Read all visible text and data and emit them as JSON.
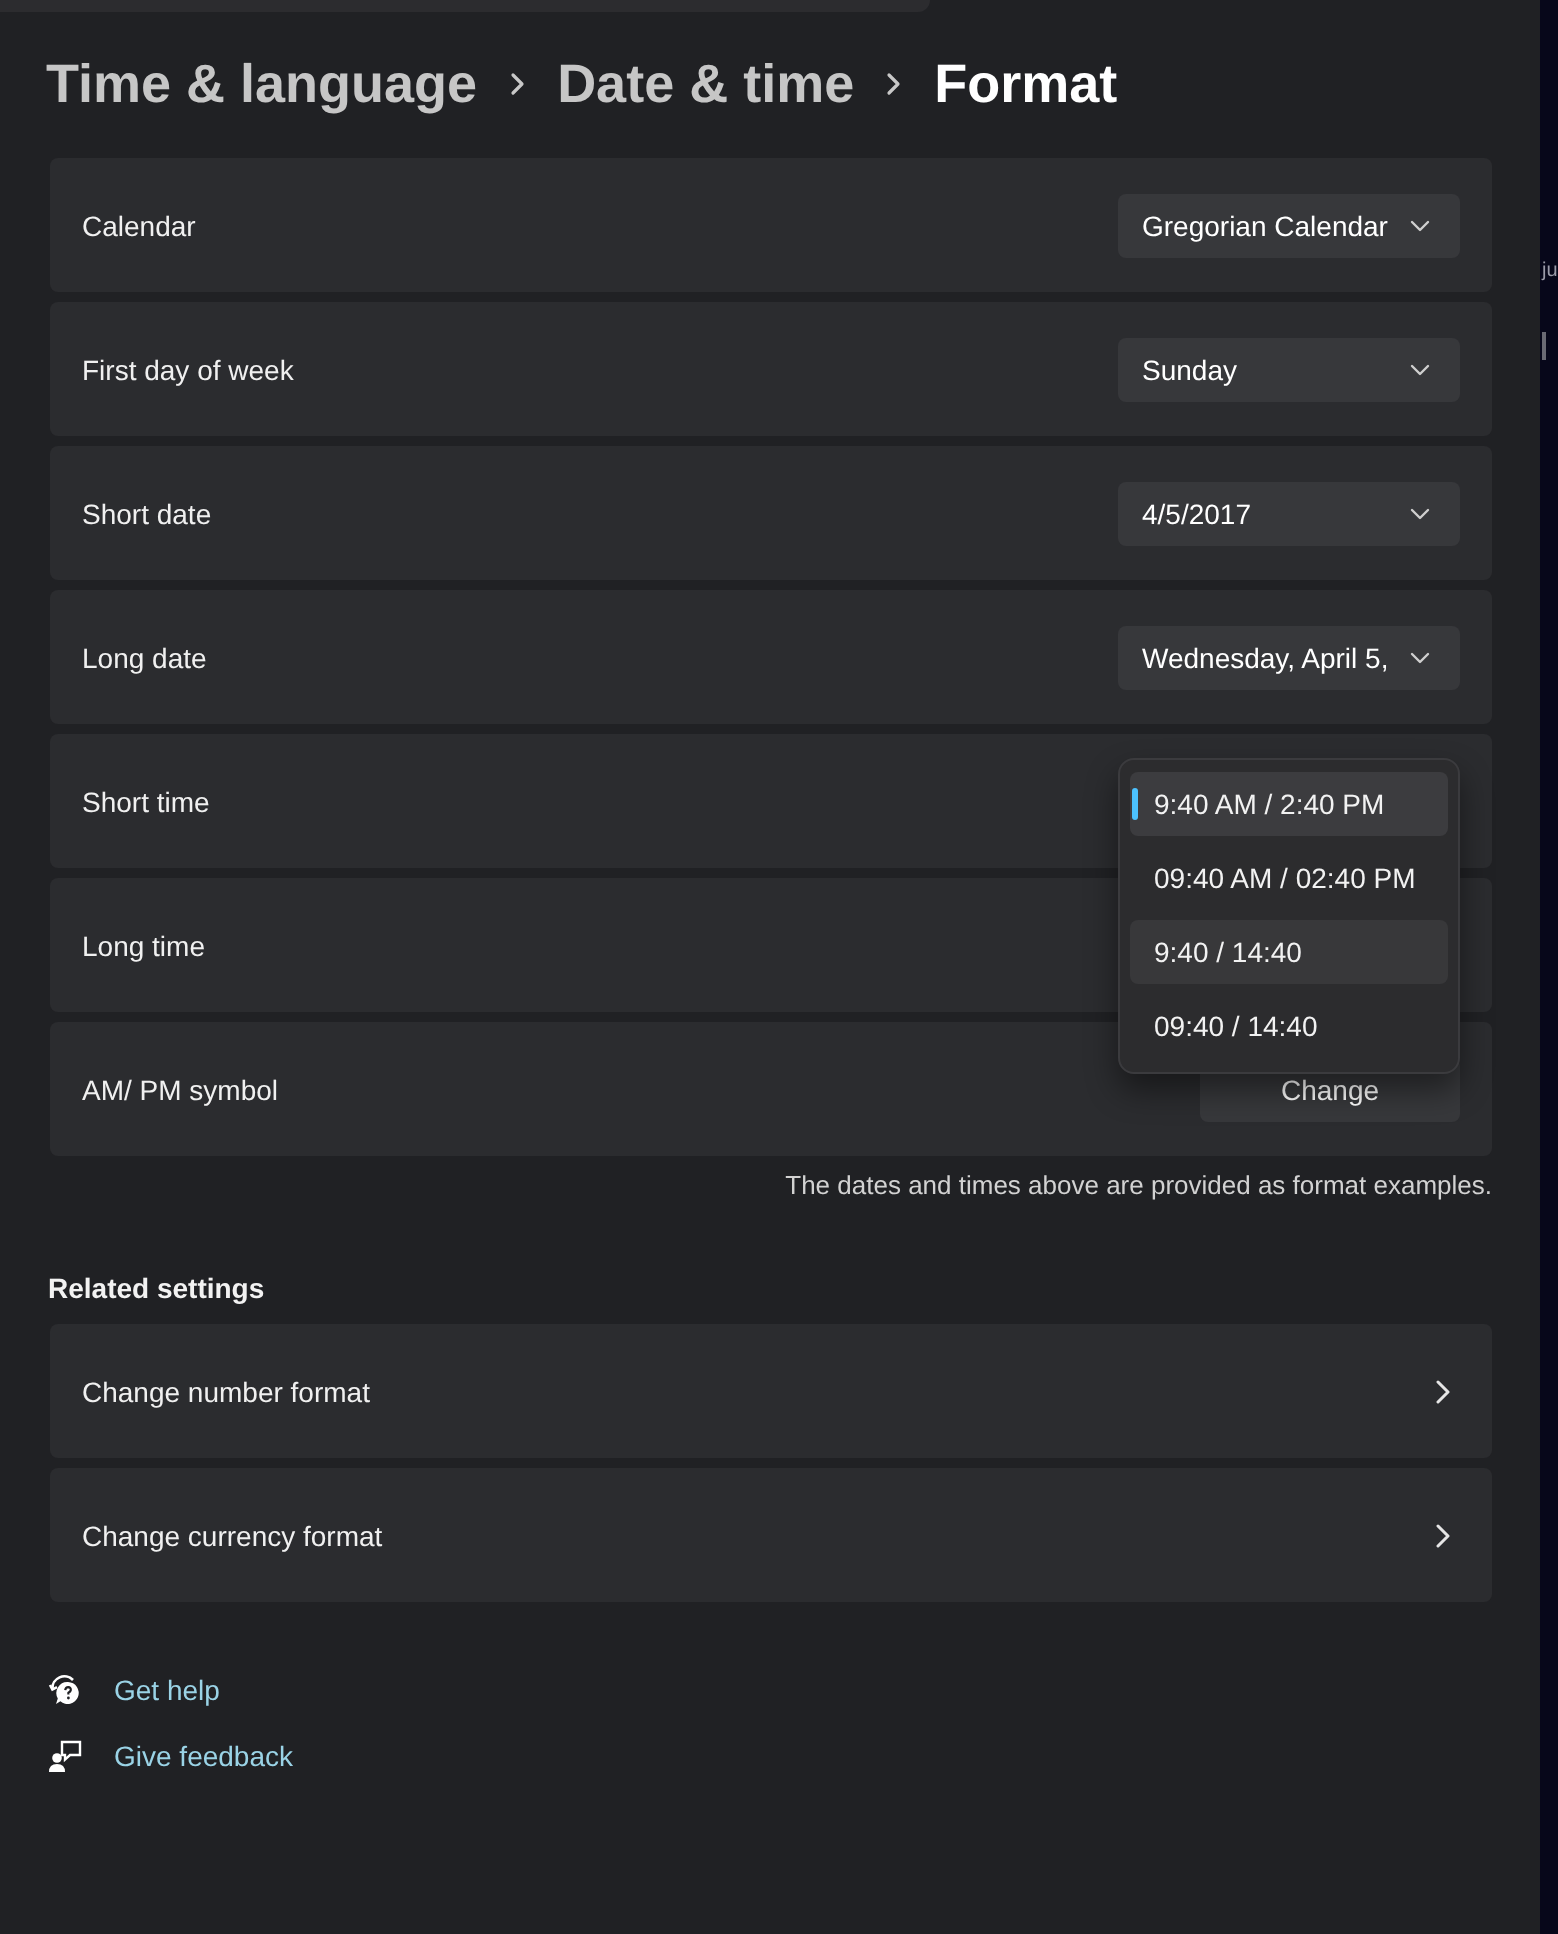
{
  "breadcrumb": [
    {
      "label": "Time & language",
      "current": false
    },
    {
      "label": "Date & time",
      "current": false
    },
    {
      "label": "Format",
      "current": true
    }
  ],
  "format_rows": [
    {
      "label": "Calendar",
      "kind": "dropdown",
      "value": "Gregorian Calendar"
    },
    {
      "label": "First day of week",
      "kind": "dropdown",
      "value": "Sunday"
    },
    {
      "label": "Short date",
      "kind": "dropdown",
      "value": "4/5/2017"
    },
    {
      "label": "Long date",
      "kind": "dropdown",
      "value": "Wednesday, April 5,"
    },
    {
      "label": "Short time",
      "kind": "open_dropdown",
      "menu": [
        {
          "label": "9:40 AM / 2:40 PM",
          "selected": true,
          "hovered": false
        },
        {
          "label": "09:40 AM / 02:40 PM",
          "selected": false,
          "hovered": false
        },
        {
          "label": "9:40 / 14:40",
          "selected": false,
          "hovered": true
        },
        {
          "label": "09:40 / 14:40",
          "selected": false,
          "hovered": false
        }
      ]
    },
    {
      "label": "Long time",
      "kind": "plain"
    },
    {
      "label": "AM/ PM symbol",
      "kind": "button",
      "button": "Change"
    }
  ],
  "note": "The dates and times above are provided as format examples.",
  "related_settings": {
    "heading": "Related settings",
    "items": [
      {
        "label": "Change number format"
      },
      {
        "label": "Change currency format"
      }
    ]
  },
  "help_links": [
    {
      "label": "Get help",
      "kind": "help"
    },
    {
      "label": "Give feedback",
      "kind": "feedback"
    }
  ],
  "background_window": {
    "text": "ju"
  }
}
